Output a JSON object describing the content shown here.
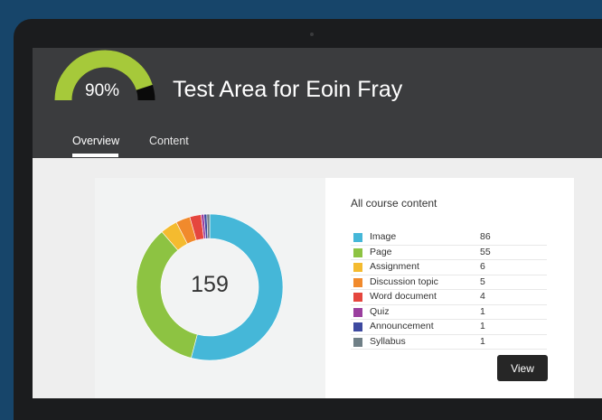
{
  "header": {
    "progress_percent": 90,
    "progress_label": "90%",
    "course_title": "Test Area for Eoin Fray"
  },
  "tabs": [
    {
      "label": "Overview",
      "active": true
    },
    {
      "label": "Content",
      "active": false
    }
  ],
  "content_summary": {
    "title": "All course content",
    "total": "159",
    "view_label": "View",
    "items": [
      {
        "label": "Image",
        "count": "86",
        "color": "#45b7d8"
      },
      {
        "label": "Page",
        "count": "55",
        "color": "#8dc342"
      },
      {
        "label": "Assignment",
        "count": "6",
        "color": "#f4bb2f"
      },
      {
        "label": "Discussion topic",
        "count": "5",
        "color": "#f18a2c"
      },
      {
        "label": "Word document",
        "count": "4",
        "color": "#e5463e"
      },
      {
        "label": "Quiz",
        "count": "1",
        "color": "#9a3f9e"
      },
      {
        "label": "Announcement",
        "count": "1",
        "color": "#3e4aa0"
      },
      {
        "label": "Syllabus",
        "count": "1",
        "color": "#6f7f86"
      }
    ]
  },
  "colors": {
    "gauge_fill": "#a6c93a",
    "gauge_empty": "#0a0a0a",
    "header_bg": "#3b3c3e"
  },
  "chart_data": {
    "type": "pie",
    "title": "",
    "categories": [
      "Image",
      "Page",
      "Assignment",
      "Discussion topic",
      "Word document",
      "Quiz",
      "Announcement",
      "Syllabus"
    ],
    "values": [
      86,
      55,
      6,
      5,
      4,
      1,
      1,
      1
    ],
    "total": 159,
    "legend_position": "right"
  }
}
